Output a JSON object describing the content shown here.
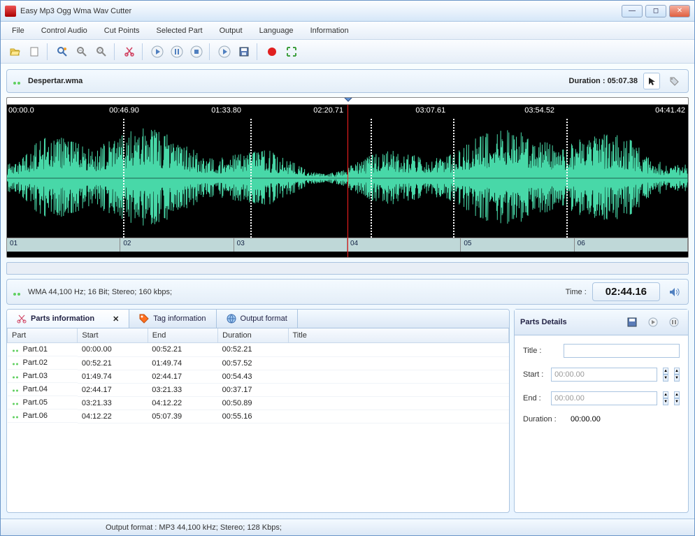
{
  "window": {
    "title": "Easy Mp3 Ogg Wma Wav Cutter"
  },
  "menu": [
    "File",
    "Control Audio",
    "Cut Points",
    "Selected Part",
    "Output",
    "Language",
    "Information"
  ],
  "file": {
    "name": "Despertar.wma",
    "duration_label": "Duration :",
    "duration": "05:07.38"
  },
  "time_marks": [
    "00:00.0",
    "00:46.90",
    "01:33.80",
    "02:20.71",
    "03:07.61",
    "03:54.52",
    "04:41.42"
  ],
  "parts_bar": [
    "01",
    "02",
    "03",
    "04",
    "05",
    "06"
  ],
  "audio_info": "WMA 44,100 Hz; 16 Bit; Stereo; 160 kbps;",
  "current_time_label": "Time :",
  "current_time": "02:44.16",
  "tabs": {
    "parts": "Parts information",
    "tag": "Tag information",
    "output": "Output format"
  },
  "table": {
    "headers": [
      "Part",
      "Start",
      "End",
      "Duration",
      "Title"
    ],
    "rows": [
      {
        "part": "Part.01",
        "start": "00:00.00",
        "end": "00:52.21",
        "duration": "00:52.21",
        "title": ""
      },
      {
        "part": "Part.02",
        "start": "00:52.21",
        "end": "01:49.74",
        "duration": "00:57.52",
        "title": ""
      },
      {
        "part": "Part.03",
        "start": "01:49.74",
        "end": "02:44.17",
        "duration": "00:54.43",
        "title": ""
      },
      {
        "part": "Part.04",
        "start": "02:44.17",
        "end": "03:21.33",
        "duration": "00:37.17",
        "title": ""
      },
      {
        "part": "Part.05",
        "start": "03:21.33",
        "end": "04:12.22",
        "duration": "00:50.89",
        "title": ""
      },
      {
        "part": "Part.06",
        "start": "04:12.22",
        "end": "05:07.39",
        "duration": "00:55.16",
        "title": ""
      }
    ]
  },
  "details": {
    "title": "Parts Details",
    "title_label": "Title :",
    "start_label": "Start :",
    "end_label": "End :",
    "duration_label": "Duration :",
    "start_value": "00:00.00",
    "end_value": "00:00.00",
    "duration_value": "00:00.00"
  },
  "status": "Output format : MP3 44,100 kHz; Stereo;  128 Kbps;",
  "cut_positions_pct": [
    17.0,
    35.7,
    53.4,
    65.5,
    82.1
  ]
}
